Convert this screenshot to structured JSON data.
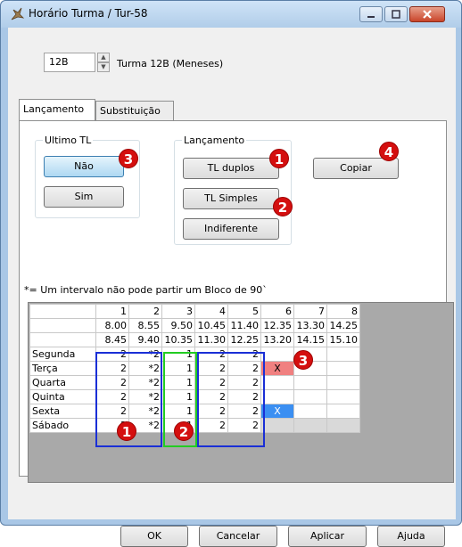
{
  "window": {
    "title": "Horário Turma / Tur-58"
  },
  "turma": {
    "code": "12B",
    "label": "Turma 12B (Meneses)"
  },
  "tabs": [
    {
      "label": "Lançamento"
    },
    {
      "label": "Substituição"
    }
  ],
  "ultimo_tl": {
    "label": "Ultimo TL",
    "buttons": [
      "Não",
      "Sim"
    ]
  },
  "lancamento": {
    "label": "Lançamento",
    "buttons": [
      "TL duplos",
      "TL Simples",
      "Indiferente"
    ]
  },
  "copiar": "Copiar",
  "note": "*= Um intervalo não pode partir um Bloco de 90`",
  "badges": [
    "1",
    "2",
    "3",
    "4",
    "3",
    "1",
    "2"
  ],
  "grid": {
    "cols": [
      "1",
      "2",
      "3",
      "4",
      "5",
      "6",
      "7",
      "8"
    ],
    "start": [
      "8.00",
      "8.55",
      "9.50",
      "10.45",
      "11.40",
      "12.35",
      "13.30",
      "14.25"
    ],
    "end": [
      "8.45",
      "9.40",
      "10.35",
      "11.30",
      "12.25",
      "13.20",
      "14.15",
      "15.10"
    ],
    "rows": [
      {
        "day": "Segunda",
        "cells": [
          "2",
          "*2",
          "1",
          "2",
          "2",
          "",
          "",
          ""
        ]
      },
      {
        "day": "Terça",
        "cells": [
          "2",
          "*2",
          "1",
          "2",
          "2",
          "X",
          "",
          ""
        ]
      },
      {
        "day": "Quarta",
        "cells": [
          "2",
          "*2",
          "1",
          "2",
          "2",
          "",
          "",
          ""
        ]
      },
      {
        "day": "Quinta",
        "cells": [
          "2",
          "*2",
          "1",
          "2",
          "2",
          "",
          "",
          ""
        ]
      },
      {
        "day": "Sexta",
        "cells": [
          "2",
          "*2",
          "1",
          "2",
          "2",
          "X",
          "",
          ""
        ]
      },
      {
        "day": "Sábado",
        "cells": [
          "2",
          "*2",
          "1",
          "2",
          "2",
          "",
          "",
          ""
        ]
      }
    ]
  },
  "footer": {
    "ok": "OK",
    "cancel": "Cancelar",
    "apply": "Aplicar",
    "help": "Ajuda"
  },
  "colors": {
    "red_badge": "#d40f0f",
    "blue_frame": "#1a2fd6",
    "green_frame": "#22cc22",
    "red_cell": "#f08080",
    "blue_cell": "#3b8ff2"
  }
}
